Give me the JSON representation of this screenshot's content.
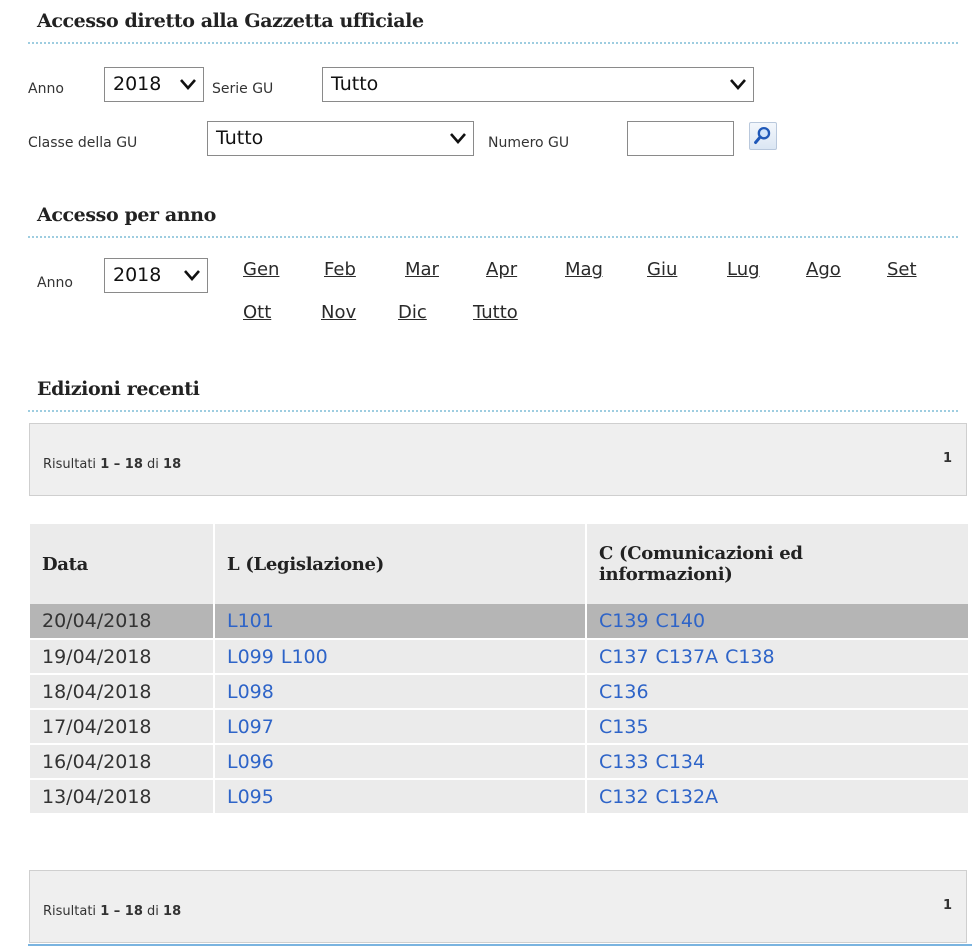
{
  "direct_access": {
    "title": "Accesso diretto alla Gazzetta ufficiale",
    "anno_label": "Anno",
    "anno_value": "2018",
    "serie_label": "Serie GU",
    "serie_value": "Tutto",
    "classe_label": "Classe della GU",
    "classe_value": "Tutto",
    "numero_label": "Numero GU",
    "numero_value": ""
  },
  "year_access": {
    "title": "Accesso per anno",
    "anno_label": "Anno",
    "anno_value": "2018",
    "months_row1": [
      "Gen",
      "Feb",
      "Mar",
      "Apr",
      "Mag",
      "Giu",
      "Lug",
      "Ago",
      "Set"
    ],
    "months_row2": [
      "Ott",
      "Nov",
      "Dic",
      "Tutto"
    ]
  },
  "recent": {
    "title": "Edizioni recenti",
    "pager": {
      "prefix": "Risultati",
      "range": "1 – 18",
      "of": "di",
      "total": "18",
      "page": "1"
    },
    "table": {
      "headers": [
        "Data",
        "L (Legislazione)",
        "C (Comunicazioni ed informazioni)"
      ],
      "rows": [
        {
          "date": "20/04/2018",
          "l": [
            "L101"
          ],
          "c": [
            "C139",
            "C140"
          ]
        },
        {
          "date": "19/04/2018",
          "l": [
            "L099",
            "L100"
          ],
          "c": [
            "C137",
            "C137A",
            "C138"
          ]
        },
        {
          "date": "18/04/2018",
          "l": [
            "L098"
          ],
          "c": [
            "C136"
          ]
        },
        {
          "date": "17/04/2018",
          "l": [
            "L097"
          ],
          "c": [
            "C135"
          ]
        },
        {
          "date": "16/04/2018",
          "l": [
            "L096"
          ],
          "c": [
            "C133",
            "C134"
          ]
        },
        {
          "date": "13/04/2018",
          "l": [
            "L095"
          ],
          "c": [
            "C132",
            "C132A"
          ]
        }
      ]
    }
  },
  "icons": {
    "search": "search-icon",
    "dropdown": "chevron-down-icon"
  },
  "colors": {
    "link": "#2e64c8",
    "highlight_row": "#b5b5b5",
    "row_bg": "#ebebeb",
    "dotted_rule": "#9ecde0"
  }
}
